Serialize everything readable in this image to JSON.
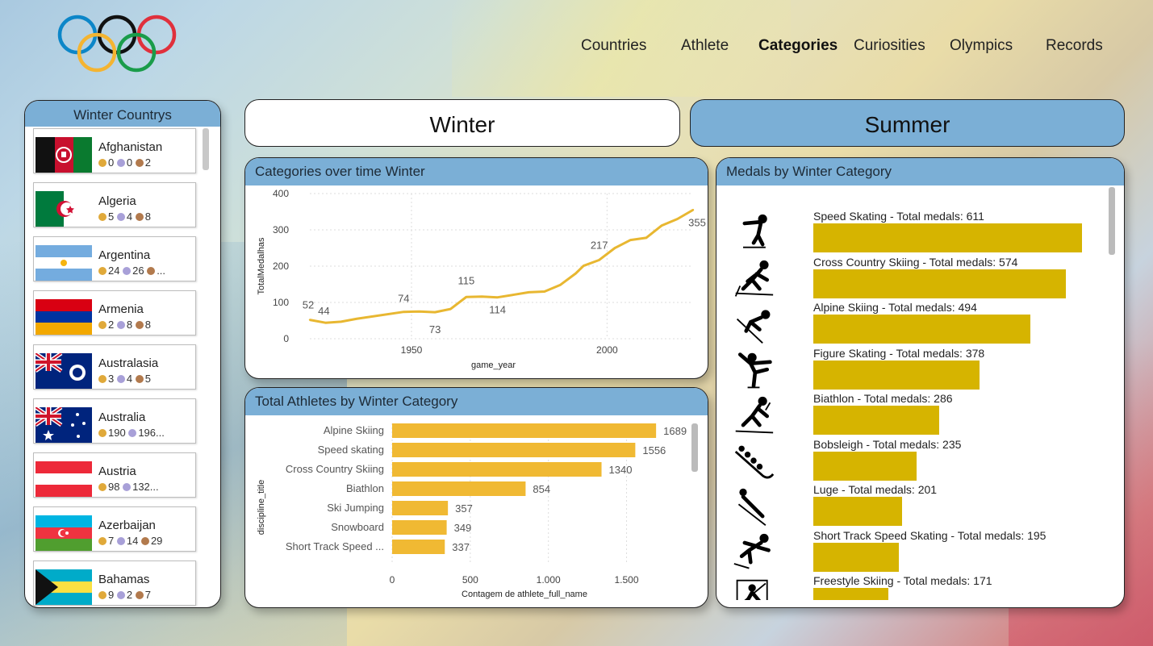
{
  "nav": {
    "items": [
      {
        "label": "Countries",
        "active": false
      },
      {
        "label": "Athlete",
        "active": false
      },
      {
        "label": "Categories",
        "active": true
      },
      {
        "label": "Curiosities",
        "active": false
      },
      {
        "label": "Olympics",
        "active": false
      },
      {
        "label": "Records",
        "active": false
      }
    ]
  },
  "countries": {
    "title": "Winter Countrys",
    "items": [
      {
        "name": "Afghanistan",
        "gold": "0",
        "silver": "0",
        "bronze": "2",
        "flag": "afghanistan"
      },
      {
        "name": "Algeria",
        "gold": "5",
        "silver": "4",
        "bronze": "8",
        "flag": "algeria"
      },
      {
        "name": "Argentina",
        "gold": "24",
        "silver": "26",
        "bronze": "...",
        "flag": "argentina"
      },
      {
        "name": "Armenia",
        "gold": "2",
        "silver": "8",
        "bronze": "8",
        "flag": "armenia"
      },
      {
        "name": "Australasia",
        "gold": "3",
        "silver": "4",
        "bronze": "5",
        "flag": "australasia"
      },
      {
        "name": "Australia",
        "gold": "190",
        "silver": "196...",
        "bronze": "",
        "flag": "australia"
      },
      {
        "name": "Austria",
        "gold": "98",
        "silver": "132...",
        "bronze": "",
        "flag": "austria"
      },
      {
        "name": "Azerbaijan",
        "gold": "7",
        "silver": "14",
        "bronze": "29",
        "flag": "azerbaijan"
      },
      {
        "name": "Bahamas",
        "gold": "9",
        "silver": "2",
        "bronze": "7",
        "flag": "bahamas"
      }
    ]
  },
  "toggles": {
    "winter": "Winter",
    "summer": "Summer"
  },
  "line_chart": {
    "title": "Categories over time Winter",
    "xlabel": "game_year",
    "ylabel": "TotalMedalhas",
    "xticks": [
      "1950",
      "2000"
    ],
    "yticks": [
      "0",
      "100",
      "200",
      "300",
      "400"
    ]
  },
  "bar_chart": {
    "title": "Total Athletes by Winter Category",
    "xlabel": "Contagem de athlete_full_name",
    "ylabel": "discipline_title",
    "xticks": [
      "0",
      "500",
      "1.000",
      "1.500"
    ]
  },
  "medals_chart": {
    "title": "Medals by Winter Category",
    "items": [
      {
        "label": "Speed Skating - Total medals: 611",
        "value": 611,
        "icon": "speed-skating-icon"
      },
      {
        "label": "Cross Country Skiing - Total medals: 574",
        "value": 574,
        "icon": "cross-country-skiing-icon"
      },
      {
        "label": "Alpine Skiing - Total medals: 494",
        "value": 494,
        "icon": "alpine-skiing-icon"
      },
      {
        "label": "Figure Skating - Total medals: 378",
        "value": 378,
        "icon": "figure-skating-icon"
      },
      {
        "label": "Biathlon - Total medals: 286",
        "value": 286,
        "icon": "biathlon-icon"
      },
      {
        "label": "Bobsleigh - Total medals: 235",
        "value": 235,
        "icon": "bobsleigh-icon"
      },
      {
        "label": "Luge - Total medals: 201",
        "value": 201,
        "icon": "luge-icon"
      },
      {
        "label": "Short Track Speed Skating - Total medals: 195",
        "value": 195,
        "icon": "short-track-icon"
      },
      {
        "label": "Freestyle Skiing - Total medals: 171",
        "value": 171,
        "icon": "freestyle-skiing-icon"
      }
    ]
  },
  "colors": {
    "header_blue": "#7bafd6",
    "line_gold": "#e8b731",
    "bar_gold": "#f0b933",
    "medal_bar": "#d6b400"
  },
  "chart_data": [
    {
      "type": "line",
      "title": "Categories over time Winter",
      "xlabel": "game_year",
      "ylabel": "TotalMedalhas",
      "xlim": [
        1924,
        2022
      ],
      "ylim": [
        0,
        400
      ],
      "x": [
        1924,
        1928,
        1932,
        1936,
        1948,
        1952,
        1956,
        1960,
        1964,
        1968,
        1972,
        1976,
        1980,
        1984,
        1988,
        1992,
        1994,
        1998,
        2002,
        2006,
        2010,
        2014,
        2018,
        2022
      ],
      "values": [
        52,
        44,
        47,
        55,
        74,
        75,
        73,
        82,
        115,
        116,
        114,
        121,
        128,
        130,
        148,
        180,
        201,
        217,
        250,
        272,
        278,
        312,
        330,
        355
      ],
      "data_labels": [
        {
          "x": 1924,
          "text": "52"
        },
        {
          "x": 1928,
          "text": "44"
        },
        {
          "x": 1948,
          "text": "74"
        },
        {
          "x": 1956,
          "text": "73"
        },
        {
          "x": 1964,
          "text": "115"
        },
        {
          "x": 1972,
          "text": "114"
        },
        {
          "x": 1998,
          "text": "217"
        },
        {
          "x": 2022,
          "text": "355"
        }
      ],
      "grid": true
    },
    {
      "type": "bar",
      "orientation": "horizontal",
      "title": "Total Athletes by Winter Category",
      "xlabel": "Contagem de athlete_full_name",
      "ylabel": "discipline_title",
      "categories": [
        "Alpine Skiing",
        "Speed skating",
        "Cross Country Skiing",
        "Biathlon",
        "Ski Jumping",
        "Snowboard",
        "Short Track Speed ..."
      ],
      "values": [
        1689,
        1556,
        1340,
        854,
        357,
        349,
        337
      ],
      "xlim": [
        0,
        1900
      ]
    },
    {
      "type": "bar",
      "orientation": "horizontal",
      "title": "Medals by Winter Category",
      "categories": [
        "Speed Skating",
        "Cross Country Skiing",
        "Alpine Skiing",
        "Figure Skating",
        "Biathlon",
        "Bobsleigh",
        "Luge",
        "Short Track Speed Skating",
        "Freestyle Skiing"
      ],
      "values": [
        611,
        574,
        494,
        378,
        286,
        235,
        201,
        195,
        171
      ]
    }
  ]
}
